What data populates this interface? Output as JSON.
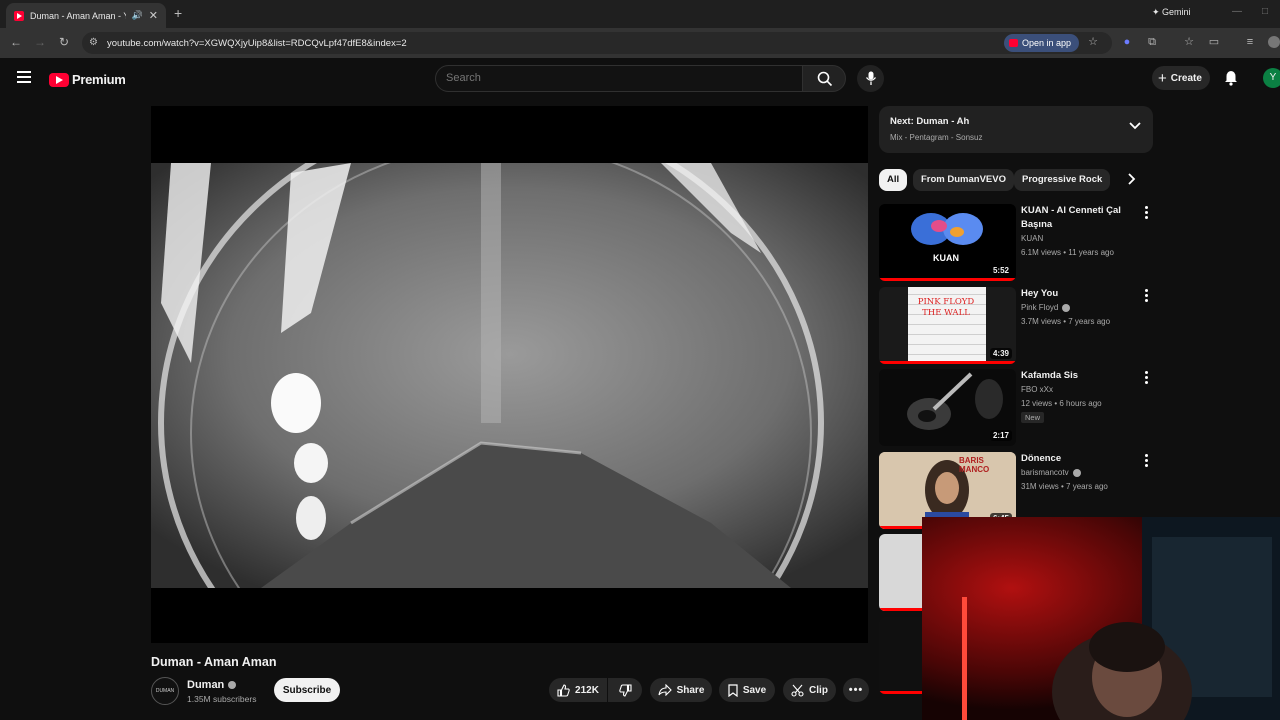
{
  "browser": {
    "tab_title": "Duman - Aman Aman - You",
    "new_tab": "+",
    "gemini_label": "Gemini",
    "url": "youtube.com/watch?v=XGWQXjyUip8&list=RDCQvLpf47dfE8&index=2",
    "open_in_app": "Open in app"
  },
  "header": {
    "logo_text": "Premium",
    "search_placeholder": "Search",
    "create_label": "Create",
    "avatar_letter": "Y"
  },
  "video": {
    "title": "Duman - Aman Aman",
    "channel_name": "Duman",
    "channel_avatar_text": "DUMAN",
    "subscribers": "1.35M subscribers",
    "subscribe_label": "Subscribe",
    "like_count": "212K",
    "share_label": "Share",
    "save_label": "Save",
    "clip_label": "Clip"
  },
  "up_next": {
    "title": "Next: Duman - Ah",
    "subtitle": "Mix - Pentagram - Sonsuz"
  },
  "chips": [
    "All",
    "From DumanVEVO",
    "Progressive Rock"
  ],
  "recommendations": [
    {
      "title": "KUAN - Al Cenneti Çal Başına",
      "channel": "KUAN",
      "meta": "6.1M views • 11 years ago",
      "duration": "5:52",
      "thumb_text": "KUAN"
    },
    {
      "title": "Hey You",
      "channel": "Pink Floyd",
      "meta": "3.7M views • 7 years ago",
      "duration": "4:39",
      "thumb_text": "PINK FLOYD THE WALL"
    },
    {
      "title": "Kafamda Sis",
      "channel": "FBO xXx",
      "meta": "12 views • 6 hours ago",
      "badge": "New",
      "duration": "2:17"
    },
    {
      "title": "Dönence",
      "channel": "barismancotv",
      "meta": "31M views • 7 years ago",
      "duration": "6:45",
      "thumb_text": "BARIS MANCO"
    }
  ],
  "colors": {
    "accent_red": "#ff0033",
    "background": "#0f0f0f",
    "chip_bg": "#272727"
  }
}
